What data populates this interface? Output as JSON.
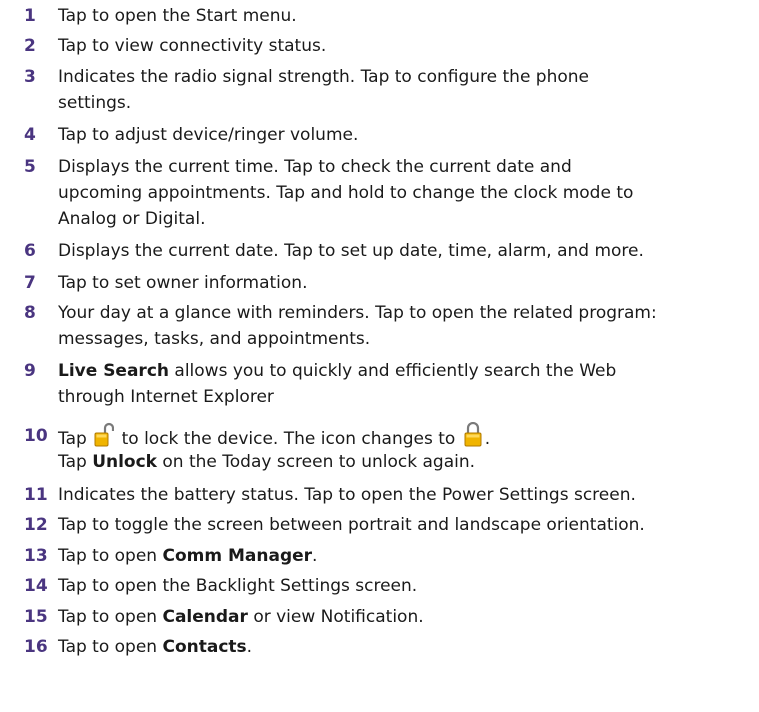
{
  "items": [
    {
      "num": "1",
      "text": "Tap to open the Start menu."
    },
    {
      "num": "2",
      "text": "Tap to view connectivity status."
    },
    {
      "num": "3",
      "text": "Indicates the radio signal strength. Tap to configure the phone",
      "text2": "settings."
    },
    {
      "num": "4",
      "text": "Tap to adjust device/ringer volume."
    },
    {
      "num": "5",
      "text": "Displays the current time. Tap to check the current date and",
      "text2": "upcoming appointments. Tap and hold to change the clock mode to",
      "text3": "Analog or Digital."
    },
    {
      "num": "6",
      "text": "Displays the current date. Tap to set up date, time, alarm, and more."
    },
    {
      "num": "7",
      "text": "Tap to set owner information."
    },
    {
      "num": "8",
      "text": "Your day at a glance with reminders. Tap to open the related program:",
      "text2": "messages, tasks, and appointments."
    },
    {
      "num": "9",
      "bold": "Live Search",
      "text": " allows you to quickly and efficiently search the Web",
      "text2": "through Internet Explorer"
    },
    {
      "num": "10",
      "pre": "Tap",
      "mid": "to lock the device. The icon changes to",
      "end": ".",
      "line2_pre": "Tap ",
      "line2_bold": "Unlock",
      "line2_post": " on the Today screen to unlock again."
    },
    {
      "num": "11",
      "text": "Indicates the battery status. Tap to open the Power Settings screen."
    },
    {
      "num": "12",
      "text": "Tap to toggle the screen between portrait and landscape orientation."
    },
    {
      "num": "13",
      "pre": "Tap to open ",
      "bold": "Comm Manager",
      "post": "."
    },
    {
      "num": "14",
      "text": "Tap to open the Backlight Settings screen."
    },
    {
      "num": "15",
      "pre": "Tap to open ",
      "bold": "Calendar",
      "post": " or view Notification."
    },
    {
      "num": "16",
      "pre": "Tap to open ",
      "bold": "Contacts",
      "post": "."
    }
  ],
  "colors": {
    "number": "#4a3580",
    "text": "#1a1a1a",
    "icon": "#e8a200"
  }
}
